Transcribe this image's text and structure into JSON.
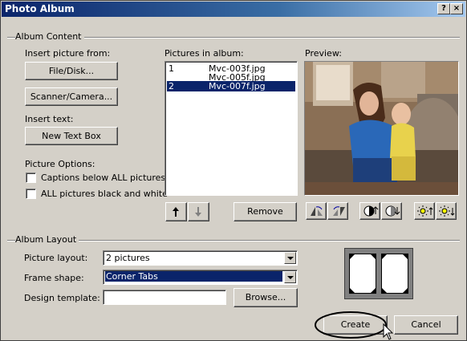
{
  "window": {
    "title": "Photo Album",
    "help_btn": "?",
    "close_btn": "×"
  },
  "album_content": {
    "group_label": "Album Content",
    "insert_picture_label": "Insert picture from:",
    "file_disk_btn": "File/Disk...",
    "scanner_btn": "Scanner/Camera...",
    "insert_text_label": "Insert text:",
    "new_text_box_btn": "New Text Box",
    "picture_options_label": "Picture Options:",
    "captions_option": "Captions below ALL pictures",
    "bw_option": "ALL pictures black and white",
    "pictures_label": "Pictures in album:",
    "pictures": [
      {
        "num": "1",
        "name": "Mvc-003f.jpg",
        "selected": false
      },
      {
        "num": "",
        "name": "Mvc-005f.jpg",
        "selected": false
      },
      {
        "num": "2",
        "name": "Mvc-007f.jpg",
        "selected": true
      }
    ],
    "remove_btn": "Remove",
    "preview_label": "Preview:"
  },
  "album_layout": {
    "group_label": "Album Layout",
    "picture_layout_label": "Picture layout:",
    "picture_layout_value": "2 pictures",
    "frame_shape_label": "Frame shape:",
    "frame_shape_value": "Corner Tabs",
    "design_template_label": "Design template:",
    "design_template_value": "",
    "browse_btn": "Browse..."
  },
  "footer": {
    "create_btn": "Create",
    "cancel_btn": "Cancel"
  }
}
